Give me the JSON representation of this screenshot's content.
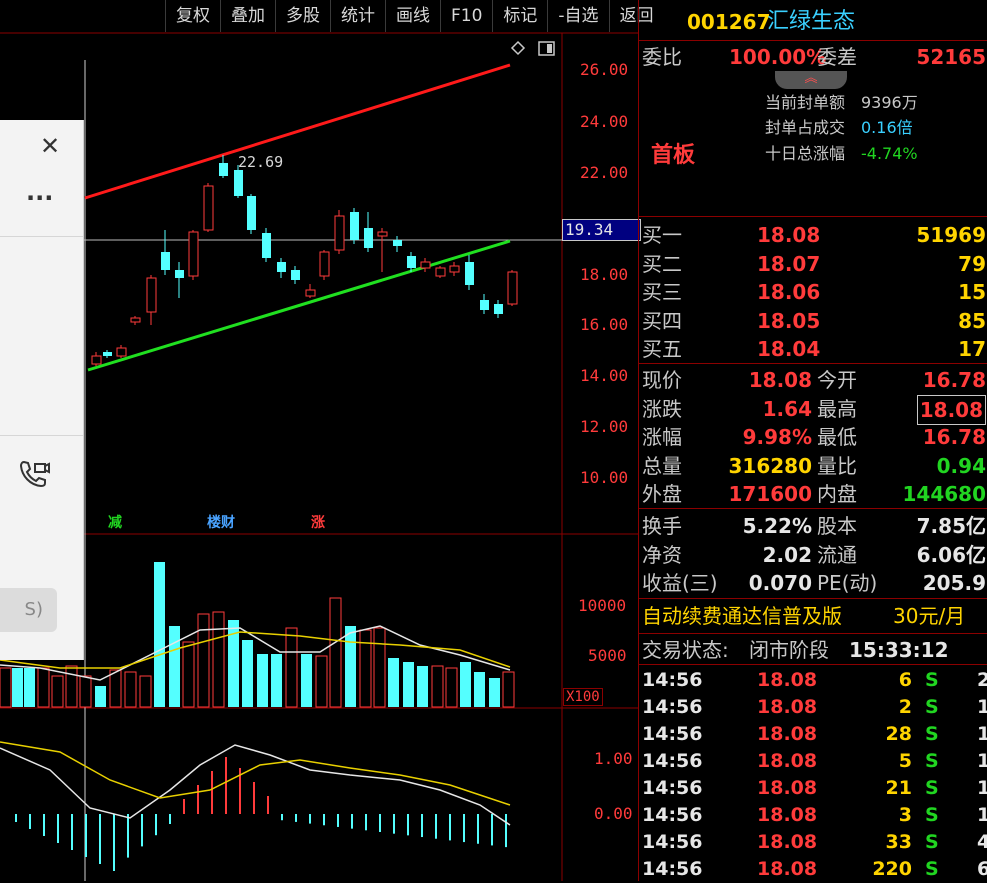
{
  "toolbar": {
    "buttons": [
      "复权",
      "叠加",
      "多股",
      "统计",
      "画线",
      "F10",
      "标记",
      "-自选",
      "返回"
    ]
  },
  "stock": {
    "code": "001267",
    "name": "汇绿生态"
  },
  "commission": {
    "label_ratio": "委比",
    "ratio": "100.00%",
    "label_diff": "委差",
    "diff": "52165"
  },
  "limit_info": {
    "badge": "首板",
    "seal_amount_label": "当前封单额",
    "seal_amount": "9396万",
    "seal_ratio_label": "封单占成交",
    "seal_ratio": "0.16倍",
    "ten_day_label": "十日总涨幅",
    "ten_day": "-4.74%"
  },
  "order_book": {
    "price_marker": "19.34",
    "buys": [
      {
        "label": "买一",
        "price": "18.08",
        "vol": "51969"
      },
      {
        "label": "买二",
        "price": "18.07",
        "vol": "79"
      },
      {
        "label": "买三",
        "price": "18.06",
        "vol": "15"
      },
      {
        "label": "买四",
        "price": "18.05",
        "vol": "85"
      },
      {
        "label": "买五",
        "price": "18.04",
        "vol": "17"
      }
    ]
  },
  "quote": {
    "rows": [
      {
        "l1": "现价",
        "v1": "18.08",
        "l2": "今开",
        "v2": "16.78"
      },
      {
        "l1": "涨跌",
        "v1": "1.64",
        "l2": "最高",
        "v2": "18.08"
      },
      {
        "l1": "涨幅",
        "v1": "9.98%",
        "l2": "最低",
        "v2": "16.78"
      },
      {
        "l1": "总量",
        "v1": "316280",
        "l2": "量比",
        "v2": "0.94"
      },
      {
        "l1": "外盘",
        "v1": "171600",
        "l2": "内盘",
        "v2": "144680"
      }
    ]
  },
  "fundamentals": {
    "rows": [
      {
        "l1": "换手",
        "v1": "5.22%",
        "l2": "股本",
        "v2": "7.85亿"
      },
      {
        "l1": "净资",
        "v1": "2.02",
        "l2": "流通",
        "v2": "6.06亿"
      },
      {
        "l1": "收益(三)",
        "v1": "0.070",
        "l2": "PE(动)",
        "v2": "205.9"
      }
    ]
  },
  "ad": {
    "text": "自动续费通达信普及版",
    "price": "30元/月"
  },
  "status": {
    "label": "交易状态:",
    "value": "闭市阶段",
    "time": "15:33:12"
  },
  "ticks": [
    {
      "time": "14:56",
      "price": "18.08",
      "vol": "6",
      "side": "S",
      "n": "2"
    },
    {
      "time": "14:56",
      "price": "18.08",
      "vol": "2",
      "side": "S",
      "n": "1"
    },
    {
      "time": "14:56",
      "price": "18.08",
      "vol": "28",
      "side": "S",
      "n": "1"
    },
    {
      "time": "14:56",
      "price": "18.08",
      "vol": "5",
      "side": "S",
      "n": "1"
    },
    {
      "time": "14:56",
      "price": "18.08",
      "vol": "21",
      "side": "S",
      "n": "1"
    },
    {
      "time": "14:56",
      "price": "18.08",
      "vol": "3",
      "side": "S",
      "n": "1"
    },
    {
      "time": "14:56",
      "price": "18.08",
      "vol": "33",
      "side": "S",
      "n": "4"
    },
    {
      "time": "14:56",
      "price": "18.08",
      "vol": "220",
      "side": "S",
      "n": "6"
    }
  ],
  "chart": {
    "price_axis": [
      "26.00",
      "24.00",
      "22.00",
      "18.00",
      "16.00",
      "14.00",
      "12.00",
      "10.00"
    ],
    "high_label": "22.69",
    "volume_axis": [
      "10000",
      "5000"
    ],
    "volume_unit": "X100",
    "macd_axis": [
      "1.00",
      "0.00"
    ],
    "markers": [
      {
        "text": "减",
        "color": "#21d521"
      },
      {
        "text": "楼财",
        "color": "#4aa3ff"
      },
      {
        "text": "涨",
        "color": "#ff3b3b"
      }
    ]
  },
  "popup": {
    "partial_text": "S)"
  },
  "colors": {
    "up": "#ff3b3b",
    "down": "#54ffff",
    "ma_white": "#e6e6e6",
    "ma_yellow": "#e8d000",
    "trend_red": "#ff1a1a",
    "trend_green": "#20e020"
  }
}
